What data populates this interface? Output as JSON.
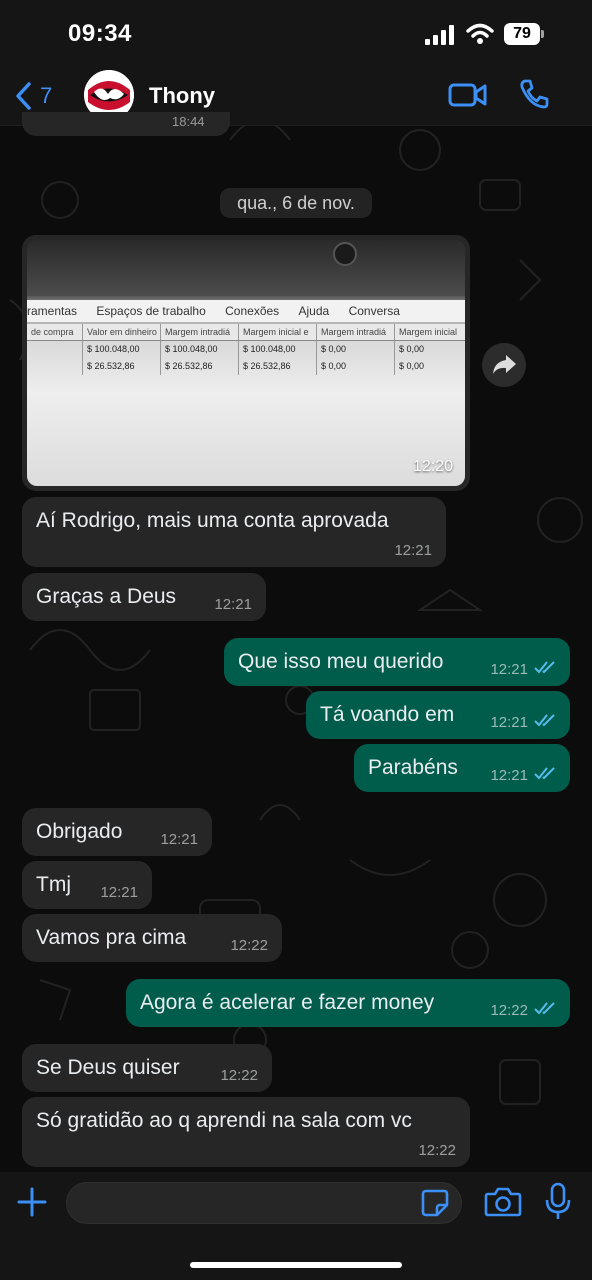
{
  "status_bar": {
    "time": "09:34",
    "battery": "79"
  },
  "header": {
    "back_count": "7",
    "contact_name": "Thony"
  },
  "chat": {
    "date_chip": "qua., 6 de nov.",
    "top_fragment_time": "18:44",
    "image_message": {
      "time": "12:20",
      "menu": [
        "ramentas",
        "Espaços de trabalho",
        "Conexões",
        "Ajuda",
        "Conversa"
      ],
      "table_header": [
        "de compra",
        "Valor em dinheiro",
        "Margem intradiá",
        "Margem inicial e",
        "Margem intradiá",
        "Margem inicial"
      ],
      "table_rows": [
        [
          "",
          "$ 100.048,00",
          "$ 100.048,00",
          "$ 100.048,00",
          "$ 0,00",
          "$ 0,00"
        ],
        [
          "",
          "$ 26.532,86",
          "$ 26.532,86",
          "$ 26.532,86",
          "$ 0,00",
          "$ 0,00"
        ]
      ]
    },
    "messages": [
      {
        "dir": "in",
        "text": "Aí Rodrigo,  mais uma conta aprovada",
        "time": "12:21"
      },
      {
        "dir": "in",
        "text": "Graças a Deus",
        "time": "12:21"
      },
      {
        "dir": "out",
        "text": "Que isso meu querido",
        "time": "12:21"
      },
      {
        "dir": "out",
        "text": "Tá voando em",
        "time": "12:21"
      },
      {
        "dir": "out",
        "text": "Parabéns",
        "time": "12:21"
      },
      {
        "dir": "in",
        "text": "Obrigado",
        "time": "12:21"
      },
      {
        "dir": "in",
        "text": "Tmj",
        "time": "12:21"
      },
      {
        "dir": "in",
        "text": "Vamos pra cima",
        "time": "12:22"
      },
      {
        "dir": "out",
        "text": "Agora é acelerar e fazer money",
        "time": "12:22"
      },
      {
        "dir": "in",
        "text": "Se Deus quiser",
        "time": "12:22"
      },
      {
        "dir": "in",
        "text": "Só gratidão ao q aprendi na sala com vc",
        "time": "12:22"
      }
    ]
  },
  "composer": {
    "placeholder": ""
  },
  "colors": {
    "accent": "#3b8ff5",
    "outgoing": "#005c4b",
    "incoming": "#262626",
    "read_ticks": "#53bdeb"
  },
  "icons": [
    "back-chevron-icon",
    "video-call-icon",
    "phone-icon",
    "forward-icon",
    "plus-icon",
    "sticker-icon",
    "camera-icon",
    "mic-icon",
    "double-check-icon"
  ]
}
